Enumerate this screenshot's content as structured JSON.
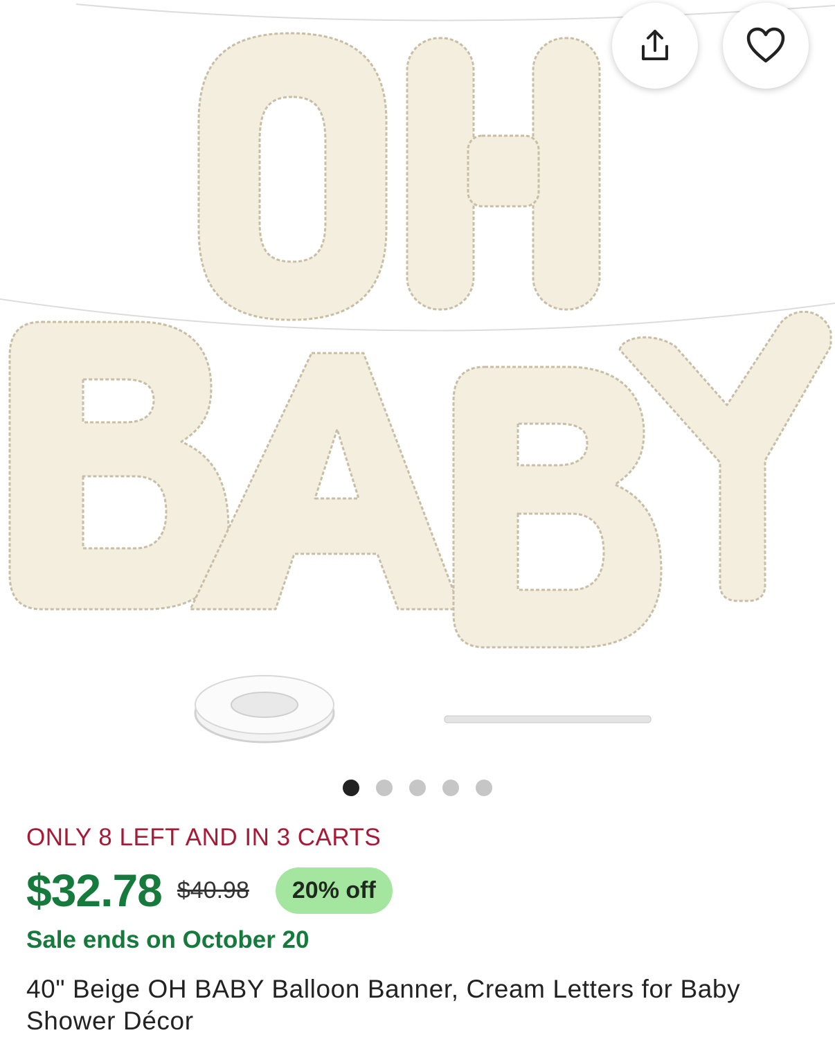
{
  "product": {
    "image_alt": "OH BABY cream foil letter balloons with ribbon spool and stick",
    "scarcity": "ONLY 8 LEFT AND IN 3 CARTS",
    "price": "$32.78",
    "original_price": "$40.98",
    "discount_badge": "20% off",
    "sale_end": "Sale ends on October 20",
    "title": "40\" Beige OH BABY Balloon Banner, Cream Letters for Baby Shower Décor"
  },
  "gallery": {
    "image_count": 5,
    "current_index": 1
  },
  "actions": {
    "share_icon": "share-icon",
    "favorite_icon": "heart-icon"
  },
  "colors": {
    "scarcity": "#a61a36",
    "price": "#157a3c",
    "badge_bg": "#a4e5a0",
    "balloon": "#f4eedf",
    "dot_active": "#222222",
    "dot_inactive": "#c6c6c6"
  }
}
